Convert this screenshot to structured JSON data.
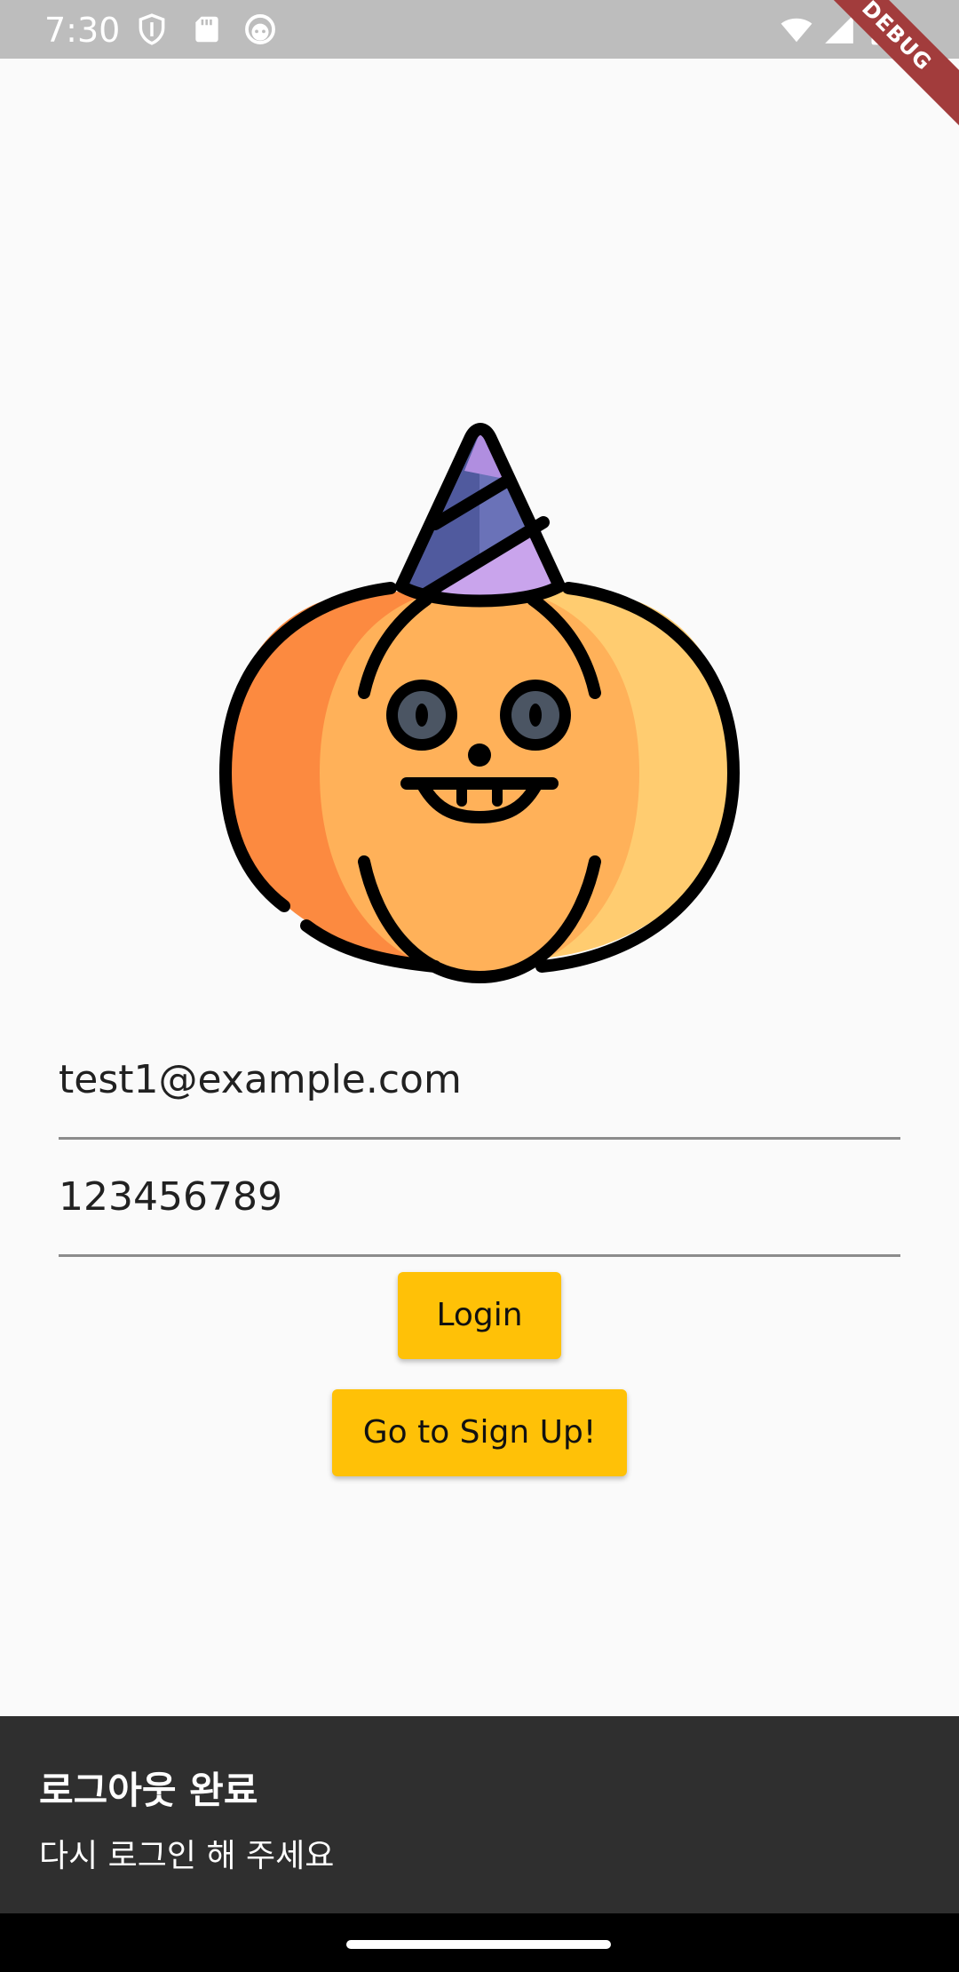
{
  "status_bar": {
    "time": "7:30",
    "icons_left": [
      "shield-icon",
      "sd-card-icon",
      "android-face-icon"
    ],
    "icons_right": [
      "wifi-icon",
      "cell-signal-icon",
      "battery-icon"
    ]
  },
  "debug_banner": {
    "label": "DEBUG"
  },
  "illustration": {
    "name": "pumpkin-party-hat-icon"
  },
  "login_form": {
    "email_value": "test1@example.com",
    "password_value": "123456789",
    "login_label": "Login",
    "signup_label": "Go to Sign Up!"
  },
  "snackbar": {
    "title": "로그아웃 완료",
    "message": "다시 로그인 해 주세요"
  },
  "colors": {
    "accent": "#ffc107",
    "status_bar": "#bdbdbd",
    "snackbar_bg": "#2f2f2f",
    "debug_banner": "#a23c3c"
  }
}
